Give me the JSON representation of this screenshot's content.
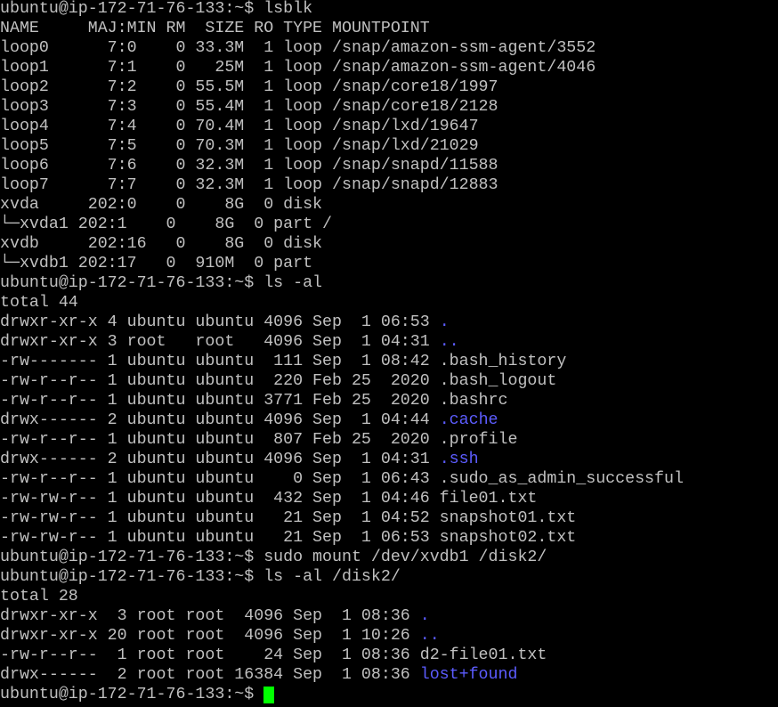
{
  "colors": {
    "background": "#000000",
    "text": "#c0c0c0",
    "directory": "#5c5cff",
    "cursor": "#00ff00"
  },
  "lines": [
    [
      {
        "text": "ubuntu@ip-172-71-76-133:~$ lsblk"
      }
    ],
    [
      {
        "text": "NAME     MAJ:MIN RM  SIZE RO TYPE MOUNTPOINT"
      }
    ],
    [
      {
        "text": "loop0      7:0    0 33.3M  1 loop /snap/amazon-ssm-agent/3552"
      }
    ],
    [
      {
        "text": "loop1      7:1    0   25M  1 loop /snap/amazon-ssm-agent/4046"
      }
    ],
    [
      {
        "text": "loop2      7:2    0 55.5M  1 loop /snap/core18/1997"
      }
    ],
    [
      {
        "text": "loop3      7:3    0 55.4M  1 loop /snap/core18/2128"
      }
    ],
    [
      {
        "text": "loop4      7:4    0 70.4M  1 loop /snap/lxd/19647"
      }
    ],
    [
      {
        "text": "loop5      7:5    0 70.3M  1 loop /snap/lxd/21029"
      }
    ],
    [
      {
        "text": "loop6      7:6    0 32.3M  1 loop /snap/snapd/11588"
      }
    ],
    [
      {
        "text": "loop7      7:7    0 32.3M  1 loop /snap/snapd/12883"
      }
    ],
    [
      {
        "text": "xvda     202:0    0    8G  0 disk"
      }
    ],
    [
      {
        "text": "└─xvda1 202:1    0    8G  0 part /"
      }
    ],
    [
      {
        "text": "xvdb     202:16   0    8G  0 disk"
      }
    ],
    [
      {
        "text": "└─xvdb1 202:17   0  910M  0 part"
      }
    ],
    [
      {
        "text": "ubuntu@ip-172-71-76-133:~$ ls -al"
      }
    ],
    [
      {
        "text": "total 44"
      }
    ],
    [
      {
        "text": "drwxr-xr-x 4 ubuntu ubuntu 4096 Sep  1 06:53 "
      },
      {
        "text": ".",
        "dir": true
      }
    ],
    [
      {
        "text": "drwxr-xr-x 3 root   root   4096 Sep  1 04:31 "
      },
      {
        "text": "..",
        "dir": true
      }
    ],
    [
      {
        "text": "-rw------- 1 ubuntu ubuntu  111 Sep  1 08:42 .bash_history"
      }
    ],
    [
      {
        "text": "-rw-r--r-- 1 ubuntu ubuntu  220 Feb 25  2020 .bash_logout"
      }
    ],
    [
      {
        "text": "-rw-r--r-- 1 ubuntu ubuntu 3771 Feb 25  2020 .bashrc"
      }
    ],
    [
      {
        "text": "drwx------ 2 ubuntu ubuntu 4096 Sep  1 04:44 "
      },
      {
        "text": ".cache",
        "dir": true
      }
    ],
    [
      {
        "text": "-rw-r--r-- 1 ubuntu ubuntu  807 Feb 25  2020 .profile"
      }
    ],
    [
      {
        "text": "drwx------ 2 ubuntu ubuntu 4096 Sep  1 04:31 "
      },
      {
        "text": ".ssh",
        "dir": true
      }
    ],
    [
      {
        "text": "-rw-r--r-- 1 ubuntu ubuntu    0 Sep  1 06:43 .sudo_as_admin_successful"
      }
    ],
    [
      {
        "text": "-rw-rw-r-- 1 ubuntu ubuntu  432 Sep  1 04:46 file01.txt"
      }
    ],
    [
      {
        "text": "-rw-rw-r-- 1 ubuntu ubuntu   21 Sep  1 04:52 snapshot01.txt"
      }
    ],
    [
      {
        "text": "-rw-rw-r-- 1 ubuntu ubuntu   21 Sep  1 06:53 snapshot02.txt"
      }
    ],
    [
      {
        "text": "ubuntu@ip-172-71-76-133:~$ sudo mount /dev/xvdb1 /disk2/"
      }
    ],
    [
      {
        "text": "ubuntu@ip-172-71-76-133:~$ ls -al /disk2/"
      }
    ],
    [
      {
        "text": "total 28"
      }
    ],
    [
      {
        "text": "drwxr-xr-x  3 root root  4096 Sep  1 08:36 "
      },
      {
        "text": ".",
        "dir": true
      }
    ],
    [
      {
        "text": "drwxr-xr-x 20 root root  4096 Sep  1 10:26 "
      },
      {
        "text": "..",
        "dir": true
      }
    ],
    [
      {
        "text": "-rw-r--r--  1 root root    24 Sep  1 08:36 d2-file01.txt"
      }
    ],
    [
      {
        "text": "drwx------  2 root root 16384 Sep  1 08:36 "
      },
      {
        "text": "lost+found",
        "dir": true
      }
    ],
    [
      {
        "text": "ubuntu@ip-172-71-76-133:~$ "
      },
      {
        "cursor": true
      }
    ]
  ]
}
